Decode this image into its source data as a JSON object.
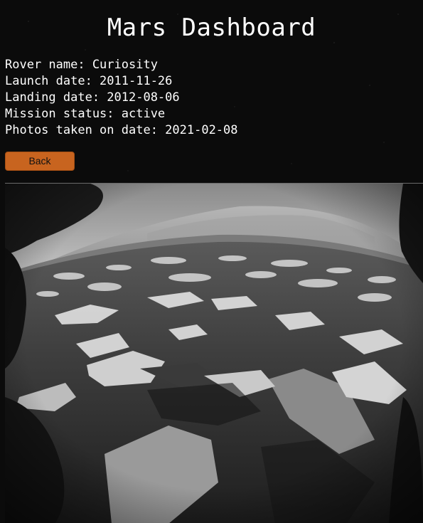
{
  "header": {
    "title": "Mars Dashboard"
  },
  "rover": {
    "name_line": "Rover name: Curiosity",
    "launch_line": "Launch date: 2011-11-26",
    "landing_line": "Landing date: 2012-08-06",
    "status_line": "Mission status: active",
    "photos_line": "Photos taken on date: 2021-02-08"
  },
  "actions": {
    "back_label": "Back"
  },
  "colors": {
    "background": "#0b0b0b",
    "text": "#ffffff",
    "back_button": "#c8641f"
  },
  "photo": {
    "description_icon": "mars-surface-photo"
  }
}
